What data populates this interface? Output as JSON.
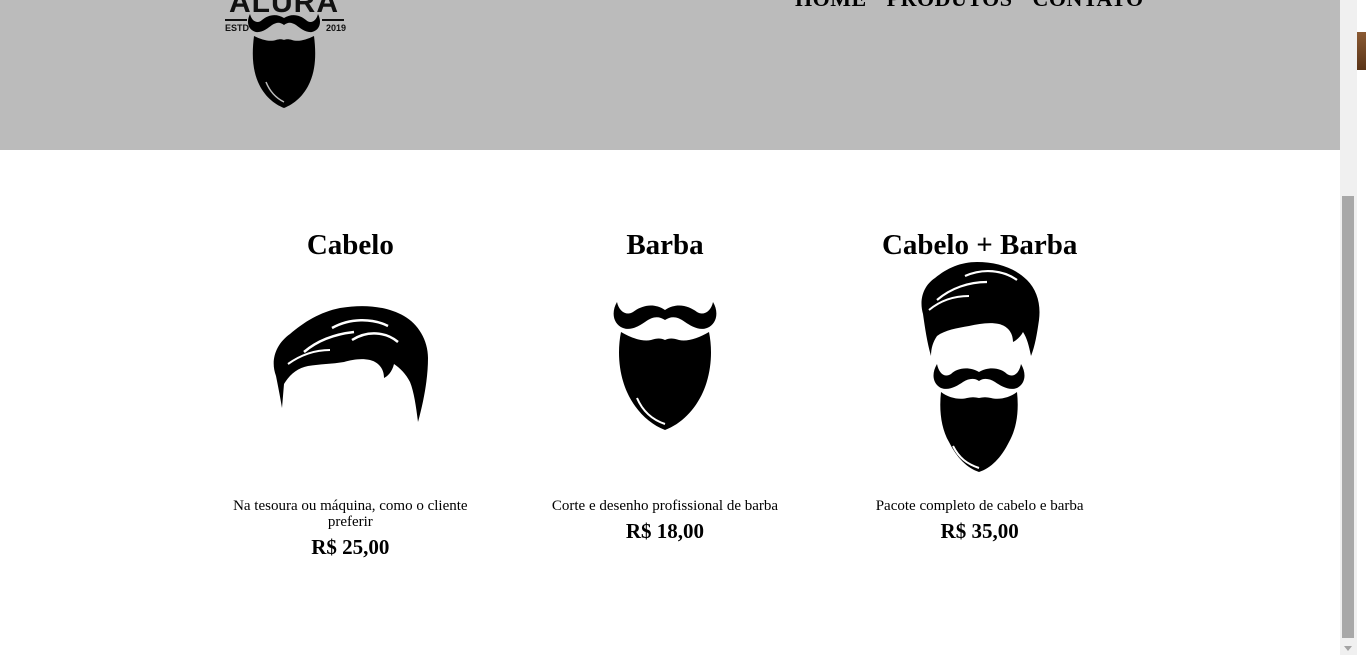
{
  "logo": {
    "brand": "ALURA",
    "estd": "ESTD",
    "year": "2019"
  },
  "nav": {
    "items": [
      {
        "label": "HOME"
      },
      {
        "label": "PRODUTOS"
      },
      {
        "label": "CONTATO"
      }
    ]
  },
  "products": [
    {
      "title": "Cabelo",
      "icon": "hair-icon",
      "description": "Na tesoura ou máquina, como o cliente preferir",
      "price": "R$ 25,00"
    },
    {
      "title": "Barba",
      "icon": "beard-icon",
      "description": "Corte e desenho profissional de barba",
      "price": "R$ 18,00"
    },
    {
      "title": "Cabelo + Barba",
      "icon": "hair-and-beard-icon",
      "description": "Pacote completo de cabelo e barba",
      "price": "R$ 35,00"
    }
  ],
  "colors": {
    "header_bg": "#bbbbbb",
    "text": "#000000",
    "icon": "#000000"
  }
}
